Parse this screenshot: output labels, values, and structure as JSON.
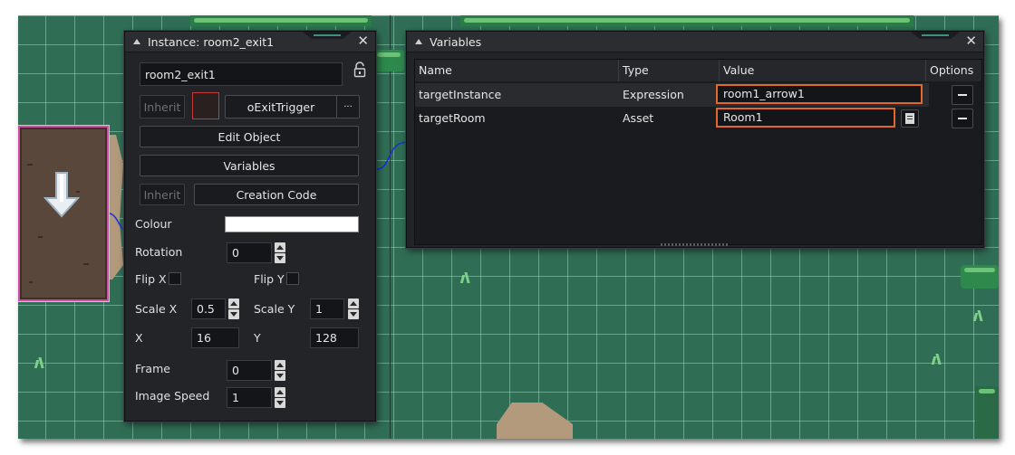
{
  "instance_panel": {
    "title": "Instance: room2_exit1",
    "name_value": "room2_exit1",
    "inherit_label": "Inherit",
    "object_name": "oExitTrigger",
    "more_label": "···",
    "edit_object_label": "Edit Object",
    "variables_label": "Variables",
    "creation_inherit_label": "Inherit",
    "creation_code_label": "Creation Code",
    "colour_label": "Colour",
    "rotation_label": "Rotation",
    "rotation_value": "0",
    "flip_x_label": "Flip X",
    "flip_y_label": "Flip Y",
    "scale_x_label": "Scale X",
    "scale_x_value": "0.5",
    "scale_y_label": "Scale Y",
    "scale_y_value": "1",
    "x_label": "X",
    "x_value": "16",
    "y_label": "Y",
    "y_value": "128",
    "frame_label": "Frame",
    "frame_value": "0",
    "image_speed_label": "Image Speed",
    "image_speed_value": "1",
    "close_glyph": "✕"
  },
  "variables_panel": {
    "title": "Variables",
    "close_glyph": "✕",
    "columns": [
      "Name",
      "Type",
      "Value",
      "Options"
    ],
    "rows": [
      {
        "name": "targetInstance",
        "type": "Expression",
        "value": "room1_arrow1"
      },
      {
        "name": "targetRoom",
        "type": "Asset",
        "value": "Room1"
      }
    ]
  },
  "colors": {
    "accent_orange": "#e2672a",
    "selection_magenta": "#d04fa6",
    "panel_bg": "#232427",
    "canvas_green": "#2f6e55",
    "colour_swatch": "#ffffff"
  },
  "icons": [
    "lock-icon",
    "close-icon",
    "collapse-triangle-icon",
    "arrow-down-icon",
    "asset-browser-icon",
    "minus-icon"
  ]
}
